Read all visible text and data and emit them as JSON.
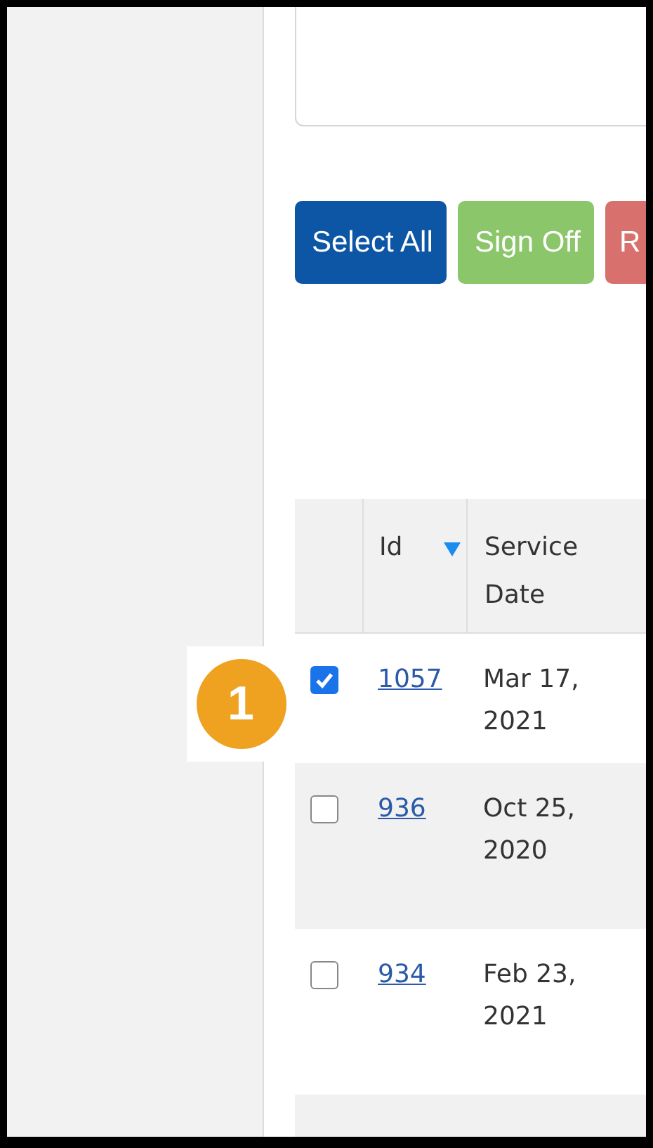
{
  "buttons": [
    {
      "label": "Select All",
      "kind": "primary"
    },
    {
      "label": "Sign Off",
      "kind": "success"
    },
    {
      "label": "R",
      "kind": "danger"
    }
  ],
  "table": {
    "columns": [
      {
        "label": "Id",
        "sorted": true
      },
      {
        "label": "Service Date"
      }
    ],
    "rows": [
      {
        "id": "1057",
        "date": "Mar 17, 2021",
        "checked": true
      },
      {
        "id": "936",
        "date": "Oct 25, 2020",
        "checked": false
      },
      {
        "id": "934",
        "date": "Feb 23, 2021",
        "checked": false
      }
    ],
    "more_rows_below": true
  },
  "callout": {
    "number": "1"
  }
}
